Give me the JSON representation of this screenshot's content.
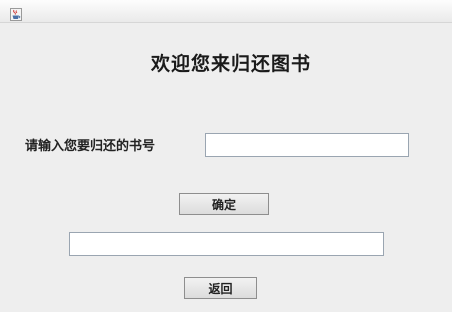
{
  "window": {
    "icon": "java-coffee-cup-icon"
  },
  "main": {
    "heading": "欢迎您来归还图书",
    "book_prompt": "请输入您要归还的书号",
    "book_number_value": "",
    "confirm_label": "确定",
    "result_value": "",
    "back_label": "返回"
  }
}
